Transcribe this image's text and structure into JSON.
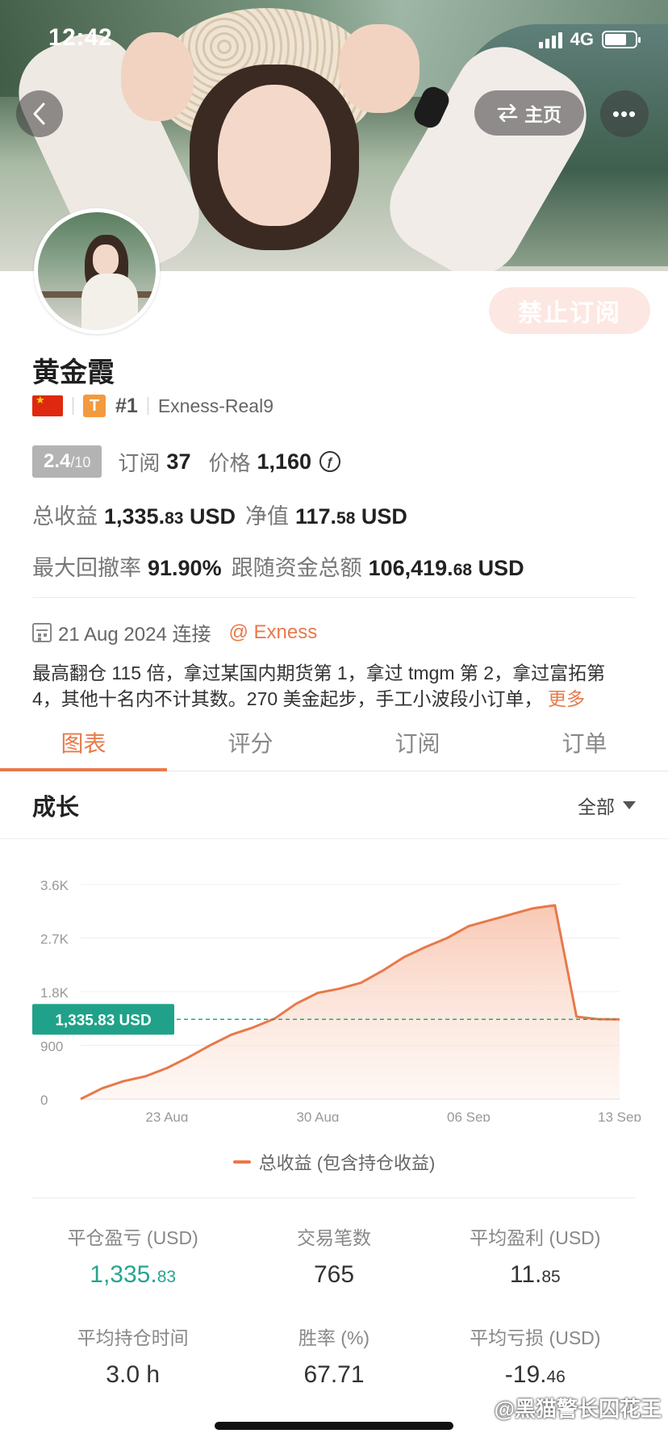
{
  "status_bar": {
    "time": "12:42",
    "network": "4G"
  },
  "nav": {
    "back_icon": "chevron-left-icon",
    "home_label": "主页",
    "home_icon": "swap-arrows-icon",
    "more_label": "•••"
  },
  "profile": {
    "subscribe_button": "禁止订阅",
    "name": "黄金霞",
    "flag": "china-flag",
    "badge_letter": "T",
    "rank": "#1",
    "broker_account": "Exness-Real9",
    "score": "2.4",
    "score_max": "/10",
    "subscriptions_label": "订阅",
    "subscriptions_value": "37",
    "price_label": "价格",
    "price_value": "1,160",
    "price_icon_glyph": "ƒ",
    "total_profit_label": "总收益",
    "total_profit_int": "1,335.",
    "total_profit_dec": "83",
    "total_profit_unit": "USD",
    "equity_label": "净值",
    "equity_int": "117.",
    "equity_dec": "58",
    "equity_unit": "USD",
    "max_drawdown_label": "最大回撤率",
    "max_drawdown_value": "91.90%",
    "follow_funds_label": "跟随资金总额",
    "follow_funds_int": "106,419.",
    "follow_funds_dec": "68",
    "follow_funds_unit": "USD",
    "connected_date": "21 Aug 2024 连接",
    "broker_link": "@ Exness",
    "bio_line1": "最高翻仓 115 倍，拿过某国内期货第 1，拿过 tmgm 第 2，拿过富拓第",
    "bio_line2": "4，其他十名内不计其数。270 美金起步，手工小波段小订单，",
    "bio_more": "更多"
  },
  "tabs": [
    {
      "label": "图表",
      "active": true
    },
    {
      "label": "评分",
      "active": false
    },
    {
      "label": "订阅",
      "active": false
    },
    {
      "label": "订单",
      "active": false
    }
  ],
  "growth": {
    "title": "成长",
    "range_label": "全部"
  },
  "chart_data": {
    "type": "area",
    "y_ticks": [
      "3.6K",
      "2.7K",
      "1.8K",
      "900",
      "0"
    ],
    "ylim": [
      0,
      3600
    ],
    "x_ticks": [
      "23 Aug",
      "30 Aug",
      "06 Sep",
      "13 Sep"
    ],
    "current_value_label": "1,335.83 USD",
    "current_value": 1335.83,
    "series": [
      {
        "name": "总收益 (包含持仓收益)",
        "color": "#e8794a",
        "x": [
          "19 Aug",
          "20 Aug",
          "21 Aug",
          "22 Aug",
          "23 Aug",
          "24 Aug",
          "25 Aug",
          "26 Aug",
          "27 Aug",
          "28 Aug",
          "29 Aug",
          "30 Aug",
          "31 Aug",
          "01 Sep",
          "02 Sep",
          "03 Sep",
          "04 Sep",
          "05 Sep",
          "06 Sep",
          "07 Sep",
          "08 Sep",
          "09 Sep",
          "10 Sep",
          "11 Sep",
          "12 Sep",
          "13 Sep"
        ],
        "values": [
          0,
          180,
          300,
          380,
          520,
          700,
          900,
          1080,
          1200,
          1350,
          1600,
          1780,
          1850,
          1950,
          2150,
          2380,
          2550,
          2700,
          2900,
          3000,
          3100,
          3200,
          3250,
          1380,
          1340,
          1335.83
        ]
      }
    ],
    "legend": "总收益 (包含持仓收益)",
    "legend_placement": "bottom-center",
    "grid": true
  },
  "stats": [
    {
      "label": "平仓盈亏 (USD)",
      "int": "1,335.",
      "dec": "83",
      "highlight": true
    },
    {
      "label": "交易笔数",
      "int": "765",
      "dec": "",
      "highlight": false
    },
    {
      "label": "平均盈利 (USD)",
      "int": "11.",
      "dec": "85",
      "highlight": false
    },
    {
      "label": "平均持仓时间",
      "int": "3.0 h",
      "dec": "",
      "highlight": false
    },
    {
      "label": "胜率 (%)",
      "int": "67.71",
      "dec": "",
      "highlight": false
    },
    {
      "label": "平均亏损 (USD)",
      "int": "-19.",
      "dec": "46",
      "highlight": false
    }
  ],
  "watermark": "@黑猫警长囚花王",
  "colors": {
    "accent": "#e8794a",
    "green": "#25a58f",
    "ban_button_bg": "#fde7e2"
  }
}
